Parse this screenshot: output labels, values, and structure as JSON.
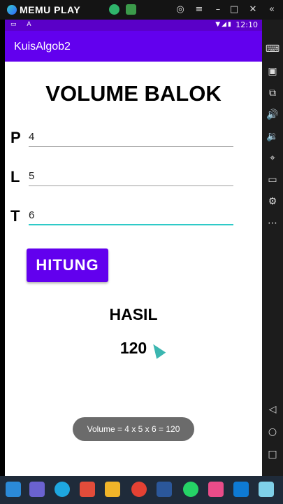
{
  "emulator": {
    "logo_text": "MEMU PLAY",
    "title_icons": [
      "minimize-icon",
      "maximize-icon",
      "close-icon",
      "collapse-icon"
    ]
  },
  "statusbar": {
    "time": "12:10",
    "icons_right": "▼◢▮",
    "icons_left": "▭ A"
  },
  "app": {
    "title": "KuisAlgob2"
  },
  "form": {
    "heading": "VOLUME BALOK",
    "fields": [
      {
        "label": "P",
        "value": "4"
      },
      {
        "label": "L",
        "value": "5"
      },
      {
        "label": "T",
        "value": "6"
      }
    ],
    "button_label": "HITUNG"
  },
  "result": {
    "label": "HASIL",
    "value": "120"
  },
  "toast": {
    "text": "Volume = 4 x 5 x 6 = 120"
  },
  "colors": {
    "primary": "#6200ee",
    "primary_dark": "#5a00c8",
    "accent": "#2ecac8",
    "toast_bg": "#6b6b6b"
  }
}
